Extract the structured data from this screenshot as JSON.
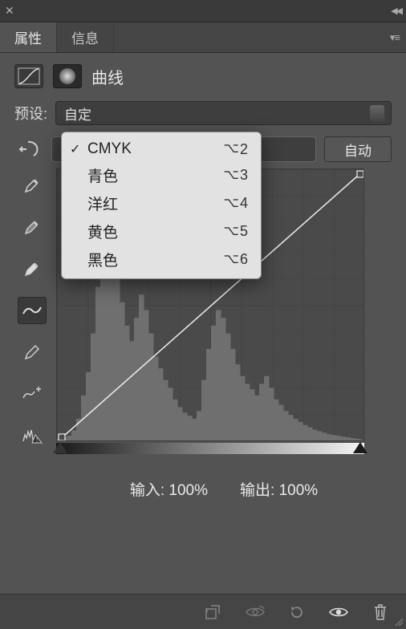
{
  "tabs": {
    "properties": "属性",
    "info": "信息"
  },
  "adjustment": {
    "title": "曲线"
  },
  "preset": {
    "label": "预设:",
    "value": "自定"
  },
  "auto_button": "自动",
  "io": {
    "input_label": "输入:",
    "input_value": "100%",
    "output_label": "输出:",
    "output_value": "100%"
  },
  "dropdown": {
    "items": [
      {
        "label": "CMYK",
        "shortcut": "2",
        "checked": true
      },
      {
        "label": "青色",
        "shortcut": "3",
        "checked": false
      },
      {
        "label": "洋红",
        "shortcut": "4",
        "checked": false
      },
      {
        "label": "黄色",
        "shortcut": "5",
        "checked": false
      },
      {
        "label": "黑色",
        "shortcut": "6",
        "checked": false
      }
    ]
  },
  "chart_data": {
    "type": "line",
    "xlim": [
      0,
      255
    ],
    "ylim": [
      0,
      255
    ],
    "curve_points": [
      [
        0,
        0
      ],
      [
        255,
        255
      ]
    ],
    "histogram": [
      4,
      6,
      8,
      15,
      30,
      60,
      90,
      140,
      200,
      260,
      310,
      260,
      220,
      180,
      150,
      130,
      160,
      190,
      170,
      140,
      110,
      95,
      80,
      70,
      55,
      45,
      38,
      34,
      30,
      40,
      80,
      120,
      150,
      170,
      160,
      140,
      120,
      100,
      85,
      75,
      68,
      60,
      75,
      85,
      70,
      55,
      48,
      40,
      35,
      30,
      26,
      22,
      19,
      16,
      14,
      12,
      10,
      9,
      8,
      7,
      6,
      5,
      4,
      3
    ]
  }
}
